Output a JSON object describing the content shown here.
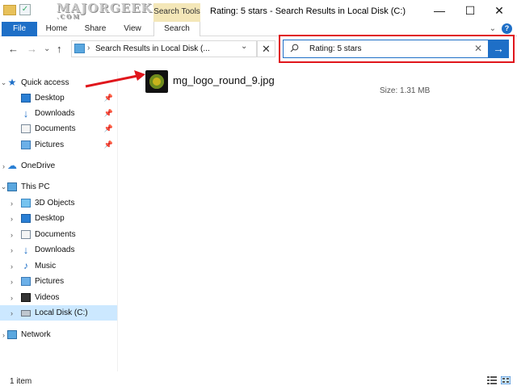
{
  "titlebar": {
    "title": "Rating: 5 stars - Search Results in Local Disk (C:)",
    "context_tab": "Search Tools",
    "watermark": "MAJORGEEKS",
    "watermark_sub": ".COM",
    "minimize": "—",
    "maximize": "☐",
    "close": "✕",
    "check_icon": "✓"
  },
  "ribbon": {
    "tabs": [
      {
        "label": "File"
      },
      {
        "label": "Home"
      },
      {
        "label": "Share"
      },
      {
        "label": "View"
      },
      {
        "label": "Search"
      }
    ],
    "expand_icon": "⌄",
    "help": "?"
  },
  "nav": {
    "back": "←",
    "forward": "→",
    "recent": "⌄",
    "up": "↑"
  },
  "address": {
    "chevron": "›",
    "text": "Search Results in Local Disk (...",
    "dropdown": "⌄",
    "close": "✕"
  },
  "search": {
    "value": "Rating: 5 stars",
    "clear": "✕",
    "go": "→"
  },
  "sidebar": {
    "pin": "📌",
    "caret_collapsed": "›",
    "caret_expanded": "⌄",
    "quick_access": "Quick access",
    "quick_items": [
      "Desktop",
      "Downloads",
      "Documents",
      "Pictures"
    ],
    "onedrive": "OneDrive",
    "this_pc": "This PC",
    "pc_items": [
      "3D Objects",
      "Desktop",
      "Documents",
      "Downloads",
      "Music",
      "Pictures",
      "Videos",
      "Local Disk (C:)"
    ],
    "network": "Network",
    "selected": "Local Disk (C:)"
  },
  "results": {
    "file_name": "mg_logo_round_9.jpg",
    "size": "Size: 1.31 MB"
  },
  "status": {
    "count": "1 item"
  },
  "colors": {
    "accent": "#1e6fc7",
    "highlight_box": "#e0161c",
    "selection": "#cce8ff",
    "context_tab": "#f4e7b8"
  }
}
